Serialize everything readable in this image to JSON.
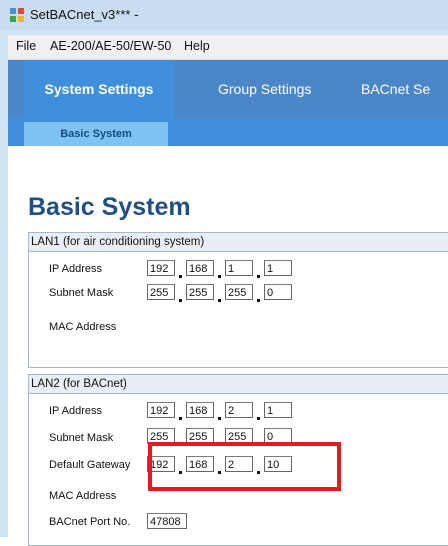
{
  "window": {
    "title": "SetBACnet_v3*** -"
  },
  "menu": [
    "File",
    "AE-200/AE-50/EW-50",
    "Help"
  ],
  "tabs": [
    "System Settings",
    "Group Settings",
    "BACnet Se"
  ],
  "subtabs": [
    "Basic System"
  ],
  "page": {
    "title": "Basic System"
  },
  "lan1": {
    "header": "LAN1 (for air conditioning system)",
    "ip_label": "IP Address",
    "ip": [
      "192",
      "168",
      "1",
      "1"
    ],
    "subnet_label": "Subnet Mask",
    "subnet": [
      "255",
      "255",
      "255",
      "0"
    ],
    "mac_label": "MAC Address"
  },
  "lan2": {
    "header": "LAN2 (for BACnet)",
    "ip_label": "IP Address",
    "ip": [
      "192",
      "168",
      "2",
      "1"
    ],
    "subnet_label": "Subnet Mask",
    "subnet": [
      "255",
      "255",
      "255",
      "0"
    ],
    "gateway_label": "Default Gateway",
    "gateway": [
      "192",
      "168",
      "2",
      "10"
    ],
    "mac_label": "MAC Address",
    "port_label": "BACnet Port No.",
    "port": "47808"
  },
  "colors": {
    "highlight": "#e31c23",
    "nav": "#4a86c8",
    "active_tab": "#3f8fdc",
    "title": "#1f4f87"
  }
}
